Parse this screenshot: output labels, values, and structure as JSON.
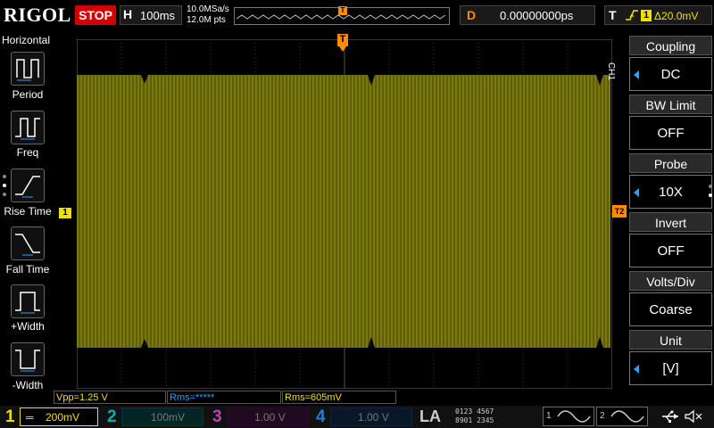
{
  "topbar": {
    "brand": "RIGOL",
    "run_state": "STOP",
    "horizontal_letter": "H",
    "timebase": "100ms",
    "sample_rate": "10.0MSa/s",
    "points": "12.0M pts",
    "trigger_marker": "T",
    "delay_letter": "D",
    "delay_value": "0.00000000ps",
    "trigger_letter": "T",
    "trigger_source": "1",
    "trigger_level": "Δ20.0mV"
  },
  "left_menu": {
    "title": "Horizontal",
    "items": [
      {
        "label": "Period"
      },
      {
        "label": "Freq"
      },
      {
        "label": "Rise Time"
      },
      {
        "label": "Fall Time"
      },
      {
        "label": "+Width"
      },
      {
        "label": "-Width"
      }
    ]
  },
  "screen": {
    "channel_marker": "1",
    "trigger_level_marker": "T2",
    "trigger_top_marker": "T"
  },
  "right_menu": {
    "channel_tag": "CH1",
    "items": [
      {
        "title": "Coupling",
        "value": "DC"
      },
      {
        "title": "BW Limit",
        "value": "OFF"
      },
      {
        "title": "Probe",
        "value": "10X"
      },
      {
        "title": "Invert",
        "value": "OFF"
      },
      {
        "title": "Volts/Div",
        "value": "Coarse"
      },
      {
        "title": "Unit",
        "value": "[V]"
      }
    ]
  },
  "measurements": {
    "vpp": "Vpp=1.25 V",
    "rms1": "Rms=*****",
    "rms2": "Rms=605mV"
  },
  "bottombar": {
    "ch1_num": "1",
    "ch1_scale": "200mV",
    "ch2_num": "2",
    "ch2_scale": "100mV",
    "ch3_num": "3",
    "ch3_scale": "1.00 V",
    "ch4_num": "4",
    "ch4_scale": "1.00 V",
    "la": "LA",
    "la_row1": "0123 4567",
    "la_row2": "8901 2345",
    "gen1": "1",
    "gen2": "2"
  },
  "colors": {
    "ch1": "#f0e000",
    "ch2": "#00d0d0",
    "ch3": "#d040d0",
    "ch4": "#2aa0ff",
    "trace": "#8a8a10",
    "stop": "#d20000",
    "delay": "#ff8c00"
  }
}
